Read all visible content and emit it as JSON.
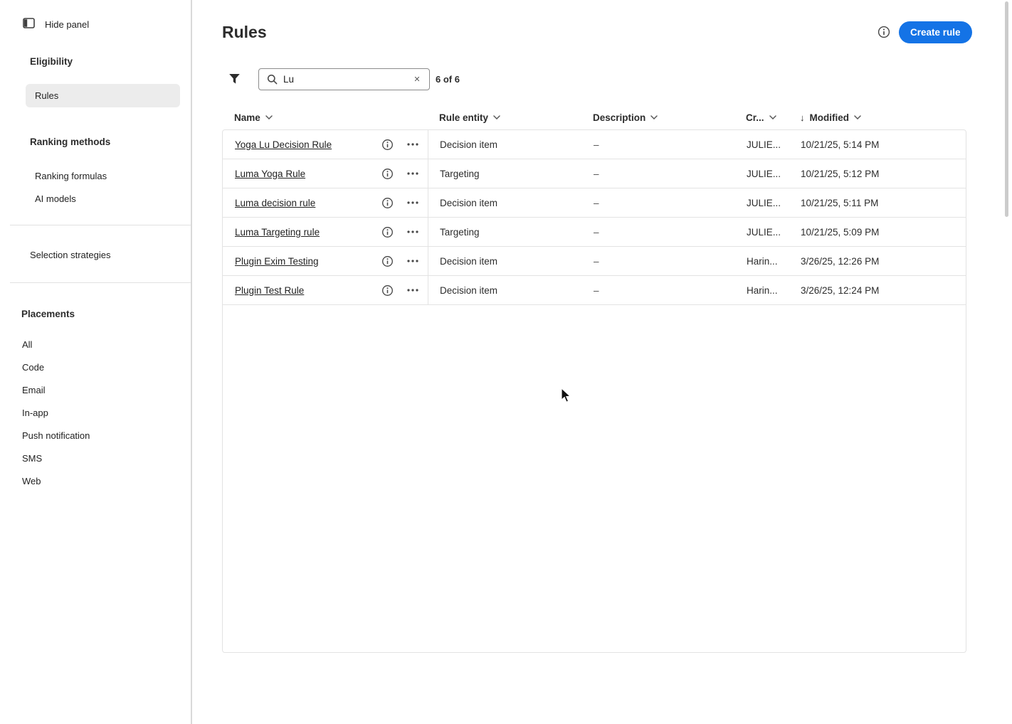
{
  "colors": {
    "accent": "#1473e6"
  },
  "sidebar": {
    "hide_panel_label": "Hide panel",
    "sections": {
      "eligibility": {
        "heading": "Eligibility",
        "items": [
          "Rules"
        ]
      },
      "ranking": {
        "heading": "Ranking methods",
        "items": [
          "Ranking formulas",
          "AI models"
        ]
      },
      "strategies_label": "Selection strategies",
      "placements": {
        "heading": "Placements",
        "items": [
          "All",
          "Code",
          "Email",
          "In-app",
          "Push notification",
          "SMS",
          "Web"
        ]
      }
    }
  },
  "header": {
    "title": "Rules",
    "create_button_label": "Create rule"
  },
  "toolbar": {
    "search_value": "Lu",
    "result_count": "6 of 6"
  },
  "table": {
    "columns": [
      "Name",
      "Rule entity",
      "Description",
      "Cr...",
      "Modified"
    ],
    "rows": [
      {
        "name": "Yoga Lu Decision Rule",
        "rule_entity": "Decision item",
        "description": "–",
        "created_by": "JULIE...",
        "modified": "10/21/25, 5:14 PM"
      },
      {
        "name": "Luma Yoga Rule",
        "rule_entity": "Targeting",
        "description": "–",
        "created_by": "JULIE...",
        "modified": "10/21/25, 5:12 PM"
      },
      {
        "name": "Luma decision rule",
        "rule_entity": "Decision item",
        "description": "–",
        "created_by": "JULIE...",
        "modified": "10/21/25, 5:11 PM"
      },
      {
        "name": "Luma Targeting rule",
        "rule_entity": "Targeting",
        "description": "–",
        "created_by": "JULIE...",
        "modified": "10/21/25, 5:09 PM"
      },
      {
        "name": "Plugin Exim Testing",
        "rule_entity": "Decision item",
        "description": "–",
        "created_by": "Harin...",
        "modified": "3/26/25, 12:26 PM"
      },
      {
        "name": "Plugin Test Rule",
        "rule_entity": "Decision item",
        "description": "–",
        "created_by": "Harin...",
        "modified": "3/26/25, 12:24 PM"
      }
    ]
  }
}
